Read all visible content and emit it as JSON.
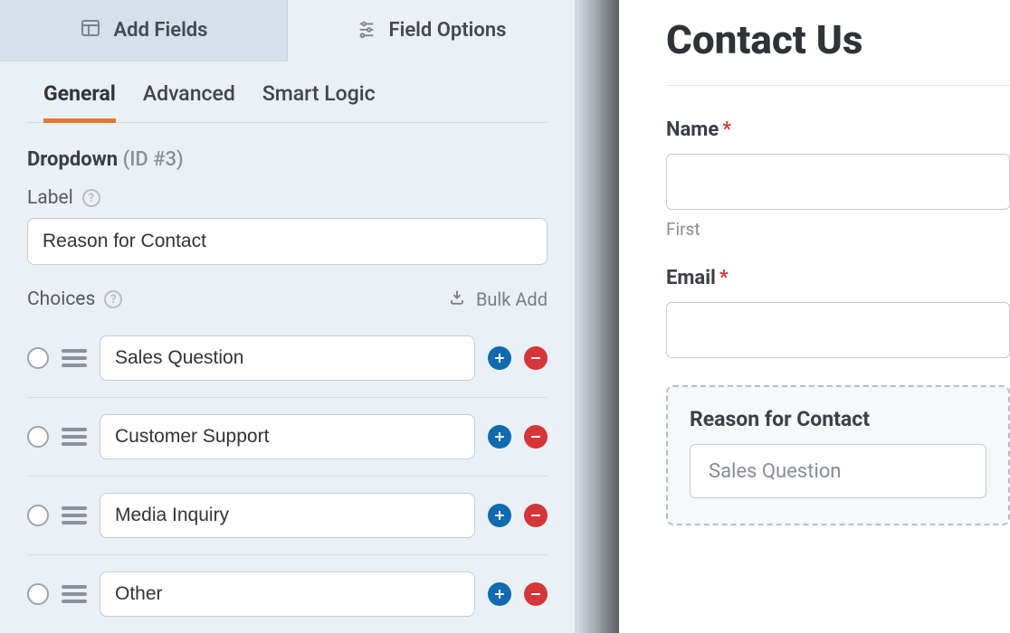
{
  "topTabs": {
    "addFields": "Add Fields",
    "fieldOptions": "Field Options"
  },
  "subTabs": {
    "general": "General",
    "advanced": "Advanced",
    "smartLogic": "Smart Logic"
  },
  "fieldHeader": {
    "type": "Dropdown",
    "id": "(ID #3)"
  },
  "labelSection": {
    "title": "Label",
    "value": "Reason for Contact"
  },
  "choicesSection": {
    "title": "Choices",
    "bulkAdd": "Bulk Add",
    "items": [
      {
        "label": "Sales Question"
      },
      {
        "label": "Customer Support"
      },
      {
        "label": "Media Inquiry"
      },
      {
        "label": "Other"
      }
    ]
  },
  "preview": {
    "formTitle": "Contact Us",
    "name": {
      "label": "Name",
      "firstSub": "First"
    },
    "email": {
      "label": "Email"
    },
    "reason": {
      "label": "Reason for Contact",
      "selected": "Sales Question"
    }
  }
}
